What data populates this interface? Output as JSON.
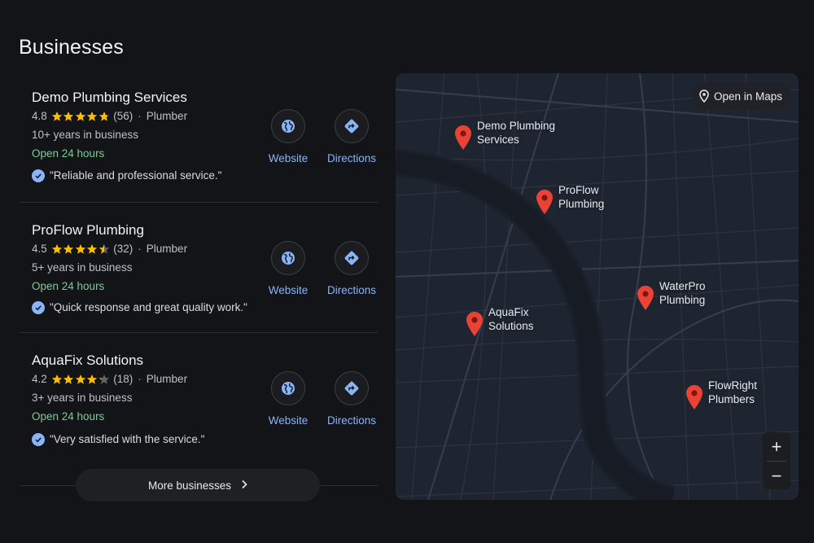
{
  "page": {
    "title": "Businesses"
  },
  "businesses": [
    {
      "name": "Demo Plumbing Services",
      "rating": "4.8",
      "rating_value": 4.8,
      "reviews": "(56)",
      "category": "Plumber",
      "years": "10+ years in business",
      "hours": "Open 24 hours",
      "review": "\"Reliable and professional service.\"",
      "website_label": "Website",
      "directions_label": "Directions"
    },
    {
      "name": "ProFlow Plumbing",
      "rating": "4.5",
      "rating_value": 4.5,
      "reviews": "(32)",
      "category": "Plumber",
      "years": "5+ years in business",
      "hours": "Open 24 hours",
      "review": "\"Quick response and great quality work.\"",
      "website_label": "Website",
      "directions_label": "Directions"
    },
    {
      "name": "AquaFix Solutions",
      "rating": "4.2",
      "rating_value": 4.2,
      "reviews": "(18)",
      "category": "Plumber",
      "years": "3+ years in business",
      "hours": "Open 24 hours",
      "review": "\"Very satisfied with the service.\"",
      "website_label": "Website",
      "directions_label": "Directions"
    }
  ],
  "more_button": {
    "label": "More businesses"
  },
  "map": {
    "open_in_maps_label": "Open in Maps",
    "zoom_in": "+",
    "zoom_out": "−",
    "pins": [
      {
        "label": "Demo Plumbing\nServices"
      },
      {
        "label": "ProFlow\nPlumbing"
      },
      {
        "label": "WaterPro\nPlumbing"
      },
      {
        "label": "AquaFix\nSolutions"
      },
      {
        "label": "FlowRight\nPlumbers"
      }
    ]
  },
  "colors": {
    "accent": "#8ab4f8",
    "open_green": "#81c995",
    "star": "#fbbc04",
    "pin": "#ea4335"
  },
  "icons": {
    "website": "globe-icon",
    "directions": "directions-icon",
    "verified": "verified-check-icon",
    "map_pin": "map-pin-icon",
    "chevron": "chevron-right-icon"
  }
}
